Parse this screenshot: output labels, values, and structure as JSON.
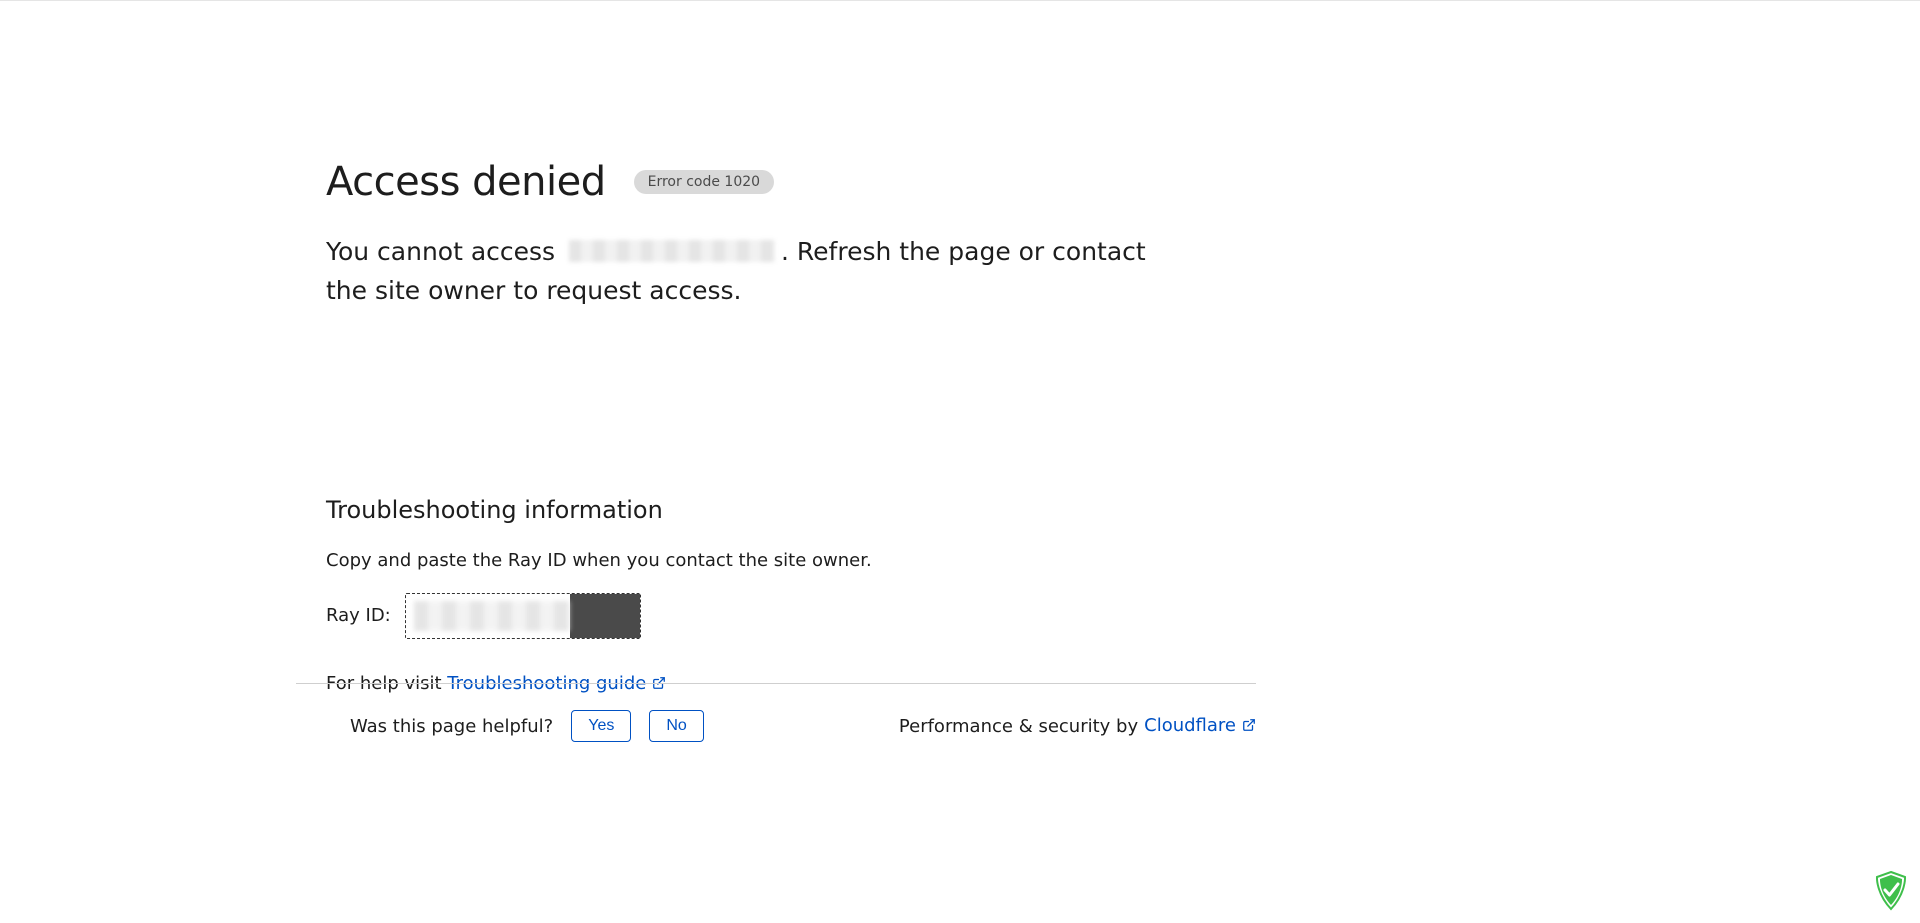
{
  "header": {
    "title": "Access denied",
    "badge": "Error code 1020"
  },
  "description": {
    "before": "You cannot access",
    "after": ". Refresh the page or contact the site owner to request access."
  },
  "troubleshoot": {
    "heading": "Troubleshooting information",
    "copy": "Copy and paste the Ray ID when you contact the site owner.",
    "ray_label": "Ray ID:",
    "help_prefix": "For help visit ",
    "help_link": "Troubleshooting guide"
  },
  "footer": {
    "question": "Was this page helpful?",
    "yes": "Yes",
    "no": "No",
    "security_prefix": "Performance & security by ",
    "cloudflare": "Cloudflare"
  }
}
